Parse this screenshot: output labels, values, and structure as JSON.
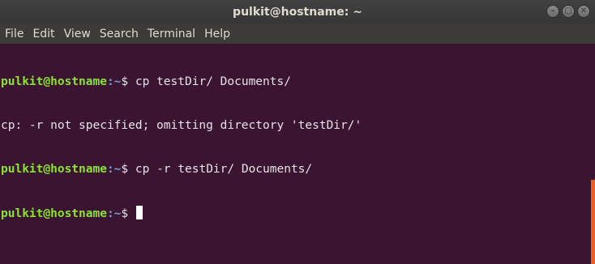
{
  "window": {
    "title": "pulkit@hostname: ~",
    "controls": [
      "–",
      "▢",
      "✕"
    ]
  },
  "menu": [
    "File",
    "Edit",
    "View",
    "Search",
    "Terminal",
    "Help"
  ],
  "terminal": {
    "lines": [
      {
        "user": "pulkit@hostname",
        "path": ":~",
        "symbol": "$ ",
        "command": "cp testDir/ Documents/"
      },
      {
        "output": "cp: -r not specified; omitting directory 'testDir/'"
      },
      {
        "user": "pulkit@hostname",
        "path": ":~",
        "symbol": "$ ",
        "command": "cp -r testDir/ Documents/"
      },
      {
        "user": "pulkit@hostname",
        "path": ":~",
        "symbol": "$ ",
        "command": ""
      }
    ]
  },
  "colors": {
    "background": "#3b1432",
    "user": "#8ae234",
    "path": "#729fcf",
    "scrollbar": "#e2612a"
  }
}
